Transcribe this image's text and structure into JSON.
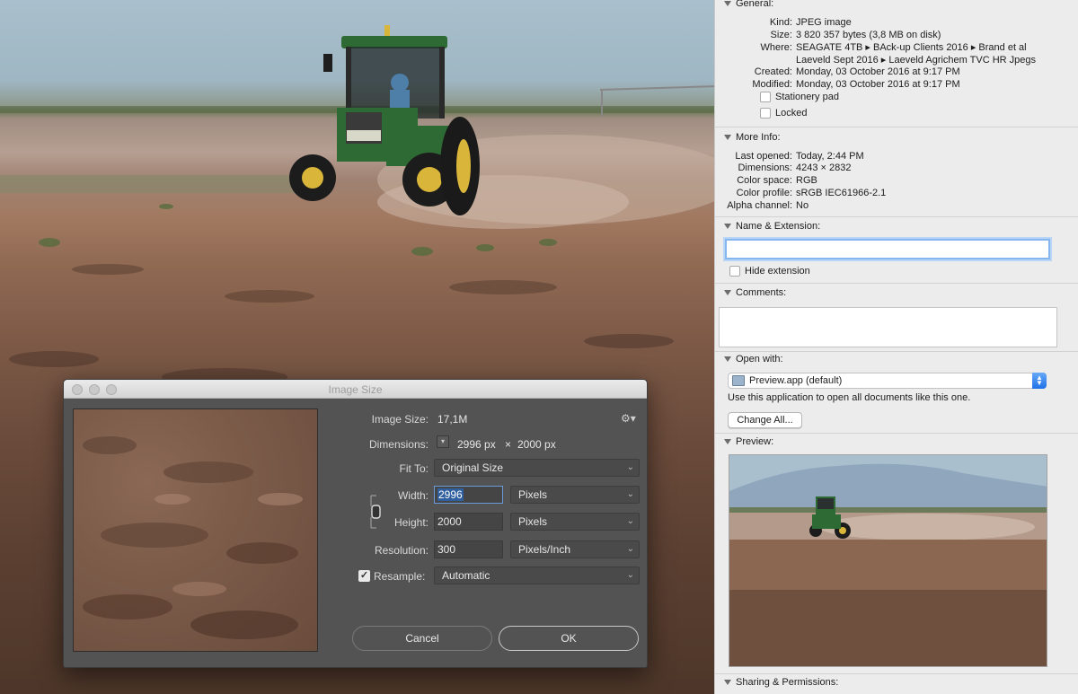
{
  "dialog": {
    "title": "Image Size",
    "image_size_label": "Image Size:",
    "image_size_value": "17,1M",
    "dimensions_label": "Dimensions:",
    "dim_width": "2996 px",
    "dim_times": "×",
    "dim_height": "2000 px",
    "fit_to_label": "Fit To:",
    "fit_to_value": "Original Size",
    "width_label": "Width:",
    "width_value": "2996",
    "width_unit": "Pixels",
    "height_label": "Height:",
    "height_value": "2000",
    "height_unit": "Pixels",
    "resolution_label": "Resolution:",
    "resolution_value": "300",
    "resolution_unit": "Pixels/Inch",
    "resample_label": "Resample:",
    "resample_checked": true,
    "resample_value": "Automatic",
    "cancel_label": "Cancel",
    "ok_label": "OK",
    "icons": [
      "gear-icon",
      "chain-link-icon",
      "checkmark-icon",
      "chevron-down-icon"
    ]
  },
  "info_panel": {
    "general": {
      "title": "General:",
      "kind_label": "Kind:",
      "kind": "JPEG image",
      "size_label": "Size:",
      "size": "3 820 357 bytes (3,8 MB on disk)",
      "where_label": "Where:",
      "where_line1": "SEAGATE 4TB ▸ BAck-up Clients 2016 ▸ Brand et al",
      "where_line2": "Laeveld Sept 2016 ▸ Laeveld Agrichem TVC HR Jpegs",
      "created_label": "Created:",
      "created": "Monday, 03 October 2016 at 9:17 PM",
      "modified_label": "Modified:",
      "modified": "Monday, 03 October 2016 at 9:17 PM",
      "stationery_label": "Stationery pad",
      "locked_label": "Locked"
    },
    "more_info": {
      "title": "More Info:",
      "last_opened_label": "Last opened:",
      "last_opened": "Today, 2:44 PM",
      "dimensions_label": "Dimensions:",
      "dimensions": "4243 × 2832",
      "color_space_label": "Color space:",
      "color_space": "RGB",
      "color_profile_label": "Color profile:",
      "color_profile": "sRGB IEC61966-2.1",
      "alpha_label": "Alpha channel:",
      "alpha": "No"
    },
    "name_ext": {
      "title": "Name & Extension:",
      "value": "",
      "hide_extension_label": "Hide extension"
    },
    "comments": {
      "title": "Comments:"
    },
    "open_with": {
      "title": "Open with:",
      "app": "Preview.app (default)",
      "hint": "Use this application to open all documents like this one.",
      "change_all_label": "Change All..."
    },
    "preview": {
      "title": "Preview:"
    },
    "sharing": {
      "title": "Sharing & Permissions:"
    }
  },
  "colors": {
    "dialog_bg": "#535353",
    "panel_bg": "#ececec",
    "focus_ring": "#86b6f0",
    "tractor_green": "#2e6b34",
    "tractor_yellow": "#d9b53a"
  }
}
